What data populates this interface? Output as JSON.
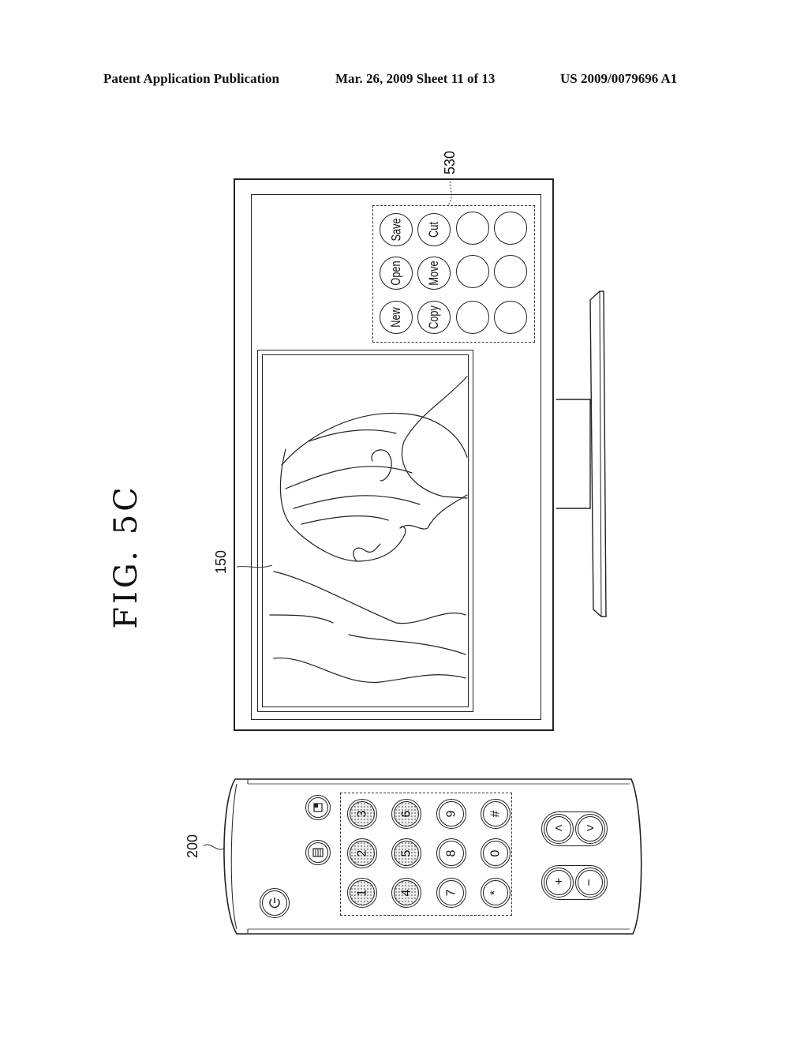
{
  "header": {
    "left": "Patent Application Publication",
    "center": "Mar. 26, 2009  Sheet 11 of 13",
    "right": "US 2009/0079696 A1"
  },
  "figure": {
    "title": "FIG. 5C"
  },
  "labels": {
    "display_window": "150",
    "menu_panel": "530",
    "remote": "200"
  },
  "tv_menu": {
    "buttons": [
      "Save",
      "Cut",
      "",
      "",
      "Open",
      "Move",
      "",
      "",
      "New",
      "Copy",
      "",
      ""
    ]
  },
  "remote": {
    "power_icon": "power-icon",
    "top_icons": [
      "folder-icon",
      "menu-icon"
    ],
    "keypad": [
      "3",
      "6",
      "9",
      "#",
      "2",
      "5",
      "8",
      "0",
      "1",
      "4",
      "7",
      "*"
    ],
    "shaded_keys": [
      "1",
      "2",
      "3",
      "4",
      "5",
      "6"
    ],
    "nav": {
      "left": "<",
      "right": ">"
    },
    "volume": {
      "plus": "+",
      "minus": "−"
    }
  }
}
